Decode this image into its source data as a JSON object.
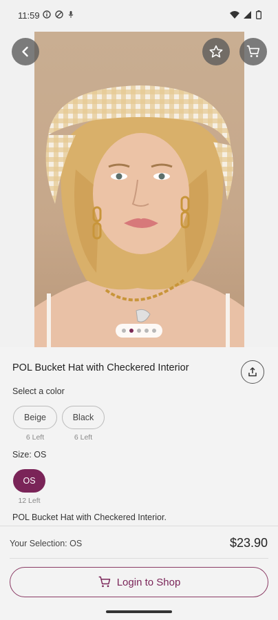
{
  "status_bar": {
    "time": "11:59"
  },
  "product": {
    "title": "POL Bucket Hat with Checkered Interior",
    "description": "POL Bucket Hat with Checkered Interior.",
    "image_count": 5,
    "active_image": 2
  },
  "color": {
    "label": "Select a color",
    "options": [
      {
        "name": "Beige",
        "stock": "6 Left"
      },
      {
        "name": "Black",
        "stock": "6 Left"
      }
    ]
  },
  "size": {
    "label": "Size: OS",
    "options": [
      {
        "name": "OS",
        "stock": "12 Left",
        "selected": true
      }
    ]
  },
  "footer": {
    "selection": "Your Selection: OS",
    "price": "$23.90",
    "login_label": "Login to Shop"
  },
  "colors": {
    "accent": "#7a2458"
  },
  "icons": {
    "back": "back-arrow-icon",
    "favorite": "star-icon",
    "cart": "cart-icon",
    "share": "share-icon"
  }
}
